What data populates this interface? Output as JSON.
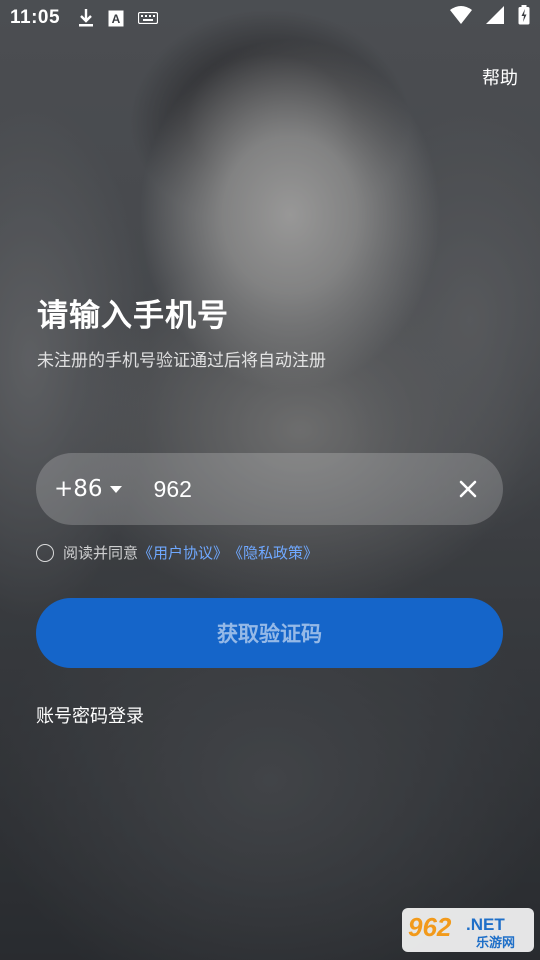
{
  "status_bar": {
    "time": "11:05",
    "left_icons": [
      "download-icon",
      "font-a-icon",
      "keyboard-icon"
    ],
    "right_icons": [
      "wifi-icon",
      "signal-icon",
      "battery-icon"
    ]
  },
  "header": {
    "help_label": "帮助"
  },
  "login": {
    "title": "请输入手机号",
    "subtitle": "未注册的手机号验证通过后将自动注册",
    "country_code": "+86",
    "phone_value": "962",
    "agreement_prefix": "阅读并同意",
    "user_agreement": "《用户协议》",
    "privacy_policy": "《隐私政策》",
    "get_code_button": "获取验证码",
    "password_login": "账号密码登录"
  },
  "watermark": {
    "brand_number": "962",
    "brand_suffix": ".NET",
    "brand_cn": "乐游网"
  },
  "colors": {
    "accent": "#1565c9",
    "link": "#6fa8ff"
  }
}
